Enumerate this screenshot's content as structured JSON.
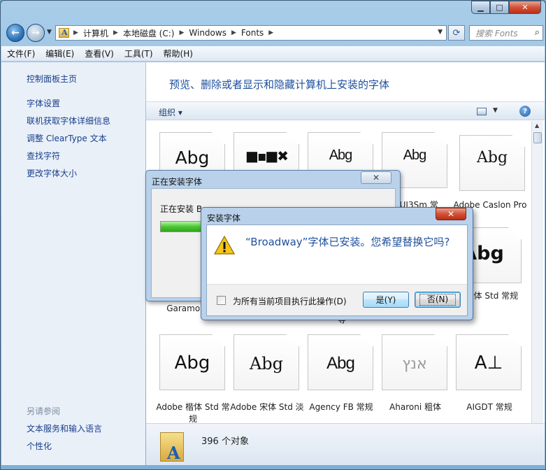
{
  "window": {
    "caption": {
      "minimize": "▁",
      "maximize": "□",
      "close": "✕"
    }
  },
  "address_bar": {
    "breadcrumbs": [
      "计算机",
      "本地磁盘 (C:)",
      "Windows",
      "Fonts"
    ],
    "search_placeholder": "搜索 Fonts"
  },
  "menu": [
    "文件(F)",
    "编辑(E)",
    "查看(V)",
    "工具(T)",
    "帮助(H)"
  ],
  "left_pane": {
    "links": [
      "控制面板主页",
      "字体设置",
      "联机获取字体详细信息",
      "调整 ClearType 文本",
      "查找字符",
      "更改字体大小"
    ],
    "see_also_heading": "另请参阅",
    "see_also_links": [
      "文本服务和输入语言",
      "个性化"
    ]
  },
  "main": {
    "title": "预览、删除或者显示和隐藏计算机上安装的字体",
    "organize_label": "组织 ▾",
    "fonts": [
      {
        "sample": "Abg",
        "label": ""
      },
      {
        "sample": "■▪■✖",
        "label": ""
      },
      {
        "sample": "Abg",
        "label": ""
      },
      {
        "sample": "Abg",
        "label": "MUI3Sm 常"
      },
      {
        "sample": "Abg",
        "label": "Adobe Caslon Pro"
      },
      {
        "sample": "",
        "label": "Garamon"
      },
      {
        "sample": "Abg",
        "label": "be 黑体 Std 常规"
      },
      {
        "sample": "",
        "label": "等"
      },
      {
        "sample": "Abg",
        "label": "Adobe 楷体 Std 常规"
      },
      {
        "sample": "Abg",
        "label": "Adobe 宋体 Std 淡"
      },
      {
        "sample": "Abg",
        "label": "Agency FB 常规"
      },
      {
        "sample": "אנץ",
        "label": "Aharoni 粗体"
      },
      {
        "sample": "A⊥",
        "label": "AIGDT 常规"
      }
    ],
    "status_text": "396 个对象"
  },
  "progress_dialog": {
    "title": "正在安装字体",
    "status_text": "正在安装 B...",
    "progress": 0.2,
    "close_label": "✕"
  },
  "confirm_dialog": {
    "title": "安装字体",
    "message": "“Broadway”字体已安装。您希望替换它吗?",
    "checkbox_label": "为所有当前项目执行此操作(D)",
    "yes_label": "是(Y)",
    "no_label": "否(N)",
    "close_label": "✕"
  }
}
